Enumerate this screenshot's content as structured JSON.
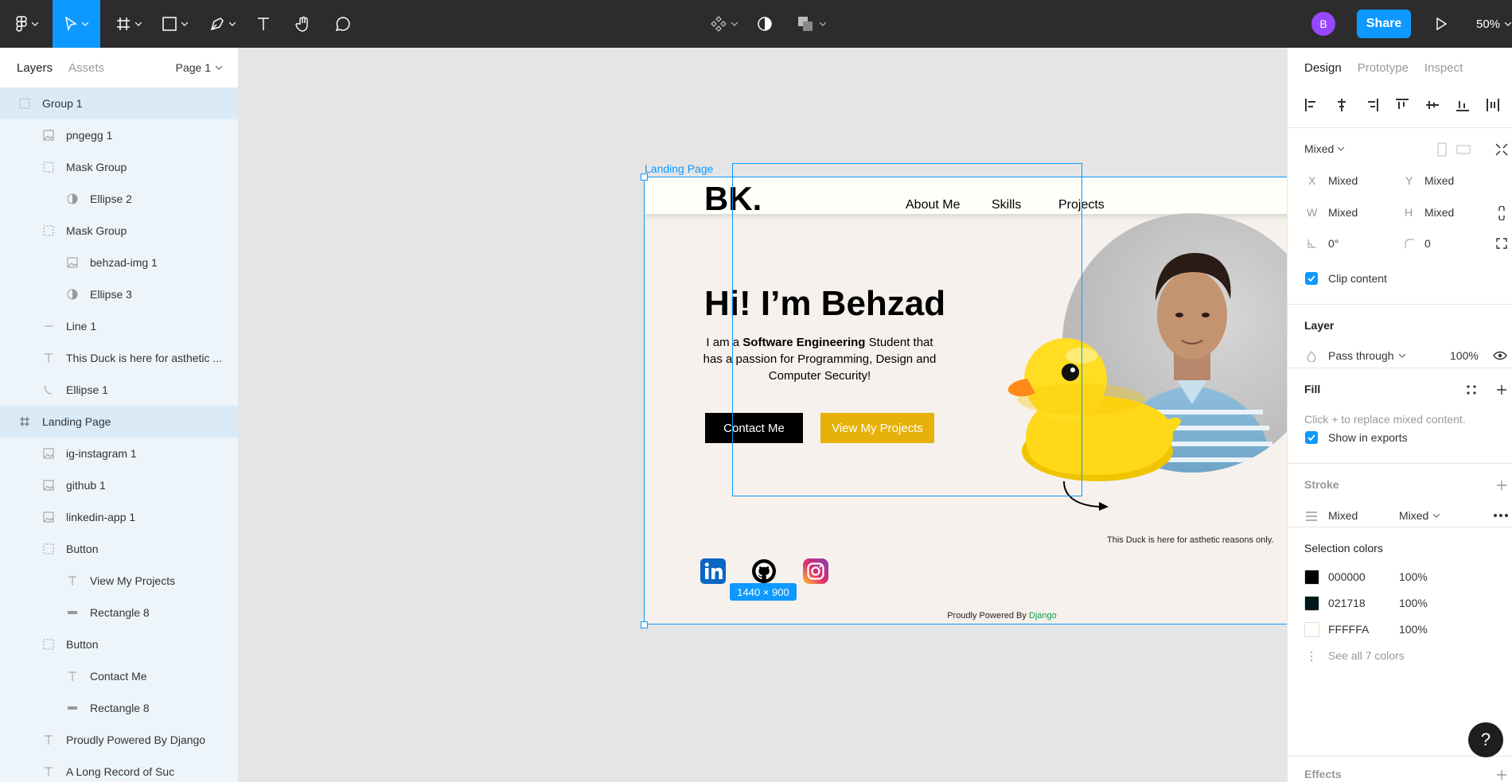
{
  "toolbar": {
    "zoom": "50%",
    "share_label": "Share",
    "avatar_initial": "B"
  },
  "left_panel": {
    "tabs": [
      "Layers",
      "Assets"
    ],
    "page": "Page 1",
    "layers": [
      {
        "label": "Group 1",
        "icon": "group-icon"
      },
      {
        "label": "pngegg 1",
        "icon": "image-icon"
      },
      {
        "label": "Mask Group",
        "icon": "group-icon"
      },
      {
        "label": "Ellipse 2",
        "icon": "mask-icon"
      },
      {
        "label": "Mask Group",
        "icon": "group-icon"
      },
      {
        "label": "behzad-img 1",
        "icon": "image-icon"
      },
      {
        "label": "Ellipse 3",
        "icon": "mask-icon"
      },
      {
        "label": "Line 1",
        "icon": "line-icon"
      },
      {
        "label": "This Duck is here for asthetic ...",
        "icon": "text-icon"
      },
      {
        "label": "Ellipse 1",
        "icon": "arc-icon"
      },
      {
        "label": "Landing Page",
        "icon": "frame-icon"
      },
      {
        "label": "ig-instagram 1",
        "icon": "image-icon"
      },
      {
        "label": "github 1",
        "icon": "image-icon"
      },
      {
        "label": "linkedin-app 1",
        "icon": "image-icon"
      },
      {
        "label": "Button",
        "icon": "group-icon"
      },
      {
        "label": "View My Projects",
        "icon": "text-icon"
      },
      {
        "label": "Rectangle 8",
        "icon": "rectangle-icon"
      },
      {
        "label": "Button",
        "icon": "group-icon"
      },
      {
        "label": "Contact Me",
        "icon": "text-icon"
      },
      {
        "label": "Rectangle 8",
        "icon": "rectangle-icon"
      },
      {
        "label": "Proudly Powered By Django",
        "icon": "text-icon"
      },
      {
        "label": "A Long Record of Suc",
        "icon": "text-icon"
      }
    ]
  },
  "canvas": {
    "frame_label": "Landing Page",
    "size_badge": "1440 × 900",
    "page": {
      "logo": "BK.",
      "nav": [
        "About Me",
        "Skills",
        "Projects"
      ],
      "hero_title": "Hi! I’m Behzad",
      "hero_text_pre": "I am a ",
      "hero_text_bold": "Software Engineering",
      "hero_text_post": " Student that has a passion for Programming, Design and Computer Security!",
      "contact_button": "Contact Me",
      "projects_button": "View My Projects",
      "duck_note": "This Duck is here for asthetic reasons only.",
      "footer_pre": "Proudly Powered By ",
      "footer_link": "Django"
    }
  },
  "right_panel": {
    "tabs": [
      "Design",
      "Prototype",
      "Inspect"
    ],
    "mixed_label": "Mixed",
    "x_label": "X",
    "x_value": "Mixed",
    "y_label": "Y",
    "y_value": "Mixed",
    "w_label": "W",
    "w_value": "Mixed",
    "h_label": "H",
    "h_value": "Mixed",
    "rotation": "0°",
    "radius": "0",
    "clip_content": "Clip content",
    "layer_title": "Layer",
    "blend_mode": "Pass through",
    "opacity": "100%",
    "fill_title": "Fill",
    "fill_hint": "Click + to replace mixed content.",
    "show_in_exports": "Show in exports",
    "stroke_title": "Stroke",
    "stroke_value": "Mixed",
    "stroke_weight": "Mixed",
    "selection_colors_title": "Selection colors",
    "colors": [
      {
        "hex": "000000",
        "swatch": "#000000",
        "opacity": "100%"
      },
      {
        "hex": "021718",
        "swatch": "#021718",
        "opacity": "100%"
      },
      {
        "hex": "FFFFFA",
        "swatch": "#FFFFFA",
        "opacity": "100%"
      }
    ],
    "see_all": "See all 7 colors",
    "effects_title": "Effects"
  },
  "help_label": "?"
}
